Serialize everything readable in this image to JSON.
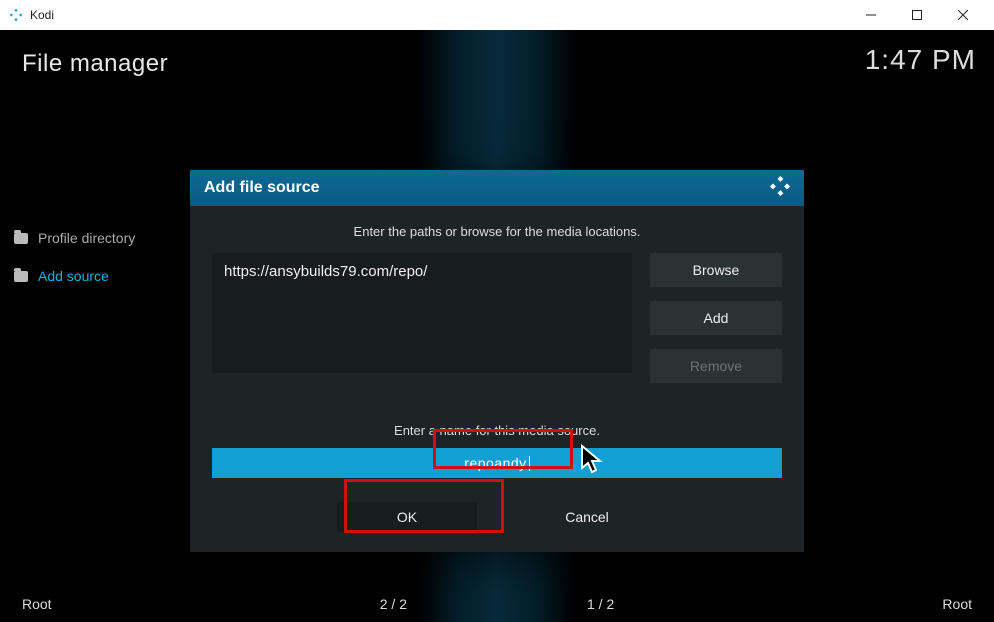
{
  "window": {
    "title": "Kodi"
  },
  "header": {
    "title": "File manager",
    "clock": "1:47 PM"
  },
  "left_list": {
    "items": [
      {
        "label": "Profile directory",
        "highlighted": false
      },
      {
        "label": "Add source",
        "highlighted": true
      }
    ]
  },
  "footer": {
    "left": "Root",
    "count_left": "2 / 2",
    "count_right": "1 / 2",
    "right": "Root"
  },
  "dialog": {
    "title": "Add file source",
    "prompt_paths": "Enter the paths or browse for the media locations.",
    "path_value": "https://ansybuilds79.com/repo/",
    "browse_label": "Browse",
    "add_label": "Add",
    "remove_label": "Remove",
    "prompt_name": "Enter a name for this media source.",
    "name_value": "repoandy",
    "ok_label": "OK",
    "cancel_label": "Cancel"
  }
}
